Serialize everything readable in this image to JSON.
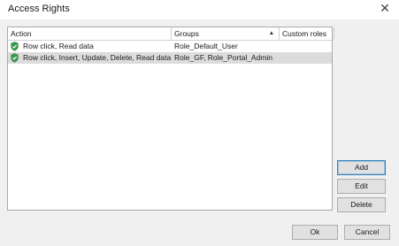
{
  "window": {
    "title": "Access Rights"
  },
  "grid": {
    "columns": [
      {
        "label": "Action"
      },
      {
        "label": "Groups",
        "sort": "ascending"
      },
      {
        "label": "Custom roles"
      }
    ],
    "rows": [
      {
        "icon": "shield-check-icon",
        "action": "Row click, Read data",
        "groups": "Role_Default_User",
        "custom_roles": "",
        "selected": false
      },
      {
        "icon": "shield-check-icon",
        "action": "Row click, Insert, Update, Delete, Read data",
        "groups": "Role_GF, Role_Portal_Admin",
        "custom_roles": "",
        "selected": true
      }
    ]
  },
  "side_buttons": {
    "add": "Add",
    "edit": "Edit",
    "delete": "Delete"
  },
  "footer_buttons": {
    "ok": "Ok",
    "cancel": "Cancel"
  },
  "colors": {
    "shield": "#3a9a4c",
    "selection": "#dcdcdc",
    "default_button_border": "#3c7fb1"
  }
}
